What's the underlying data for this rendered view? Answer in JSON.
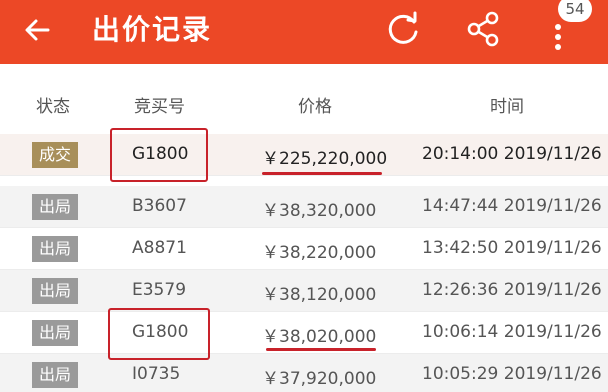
{
  "header": {
    "title": "出价记录",
    "badge": "54",
    "background": "#ec4826"
  },
  "table": {
    "columns": [
      "状态",
      "竞买号",
      "价格",
      "时间"
    ],
    "rows": [
      {
        "status": "成交",
        "status_color": "#a88f5a",
        "bid": "G1800",
        "price": "￥225,220,000",
        "time": "20:14:00 2019/11/26"
      },
      {
        "status": "出局",
        "status_color": "#9a9a9a",
        "bid": "B3607",
        "price": "￥38,320,000",
        "time": "14:47:44 2019/11/26"
      },
      {
        "status": "出局",
        "status_color": "#9a9a9a",
        "bid": "A8871",
        "price": "￥38,220,000",
        "time": "13:42:50 2019/11/26"
      },
      {
        "status": "出局",
        "status_color": "#9a9a9a",
        "bid": "E3579",
        "price": "￥38,120,000",
        "time": "12:26:36 2019/11/26"
      },
      {
        "status": "出局",
        "status_color": "#9a9a9a",
        "bid": "G1800",
        "price": "￥38,020,000",
        "time": "10:06:14 2019/11/26"
      },
      {
        "status": "出局",
        "status_color": "#9a9a9a",
        "bid": "I0735",
        "price": "￥37,920,000",
        "time": "10:05:29 2019/11/26"
      }
    ]
  },
  "annotation_color": "#c8222a"
}
